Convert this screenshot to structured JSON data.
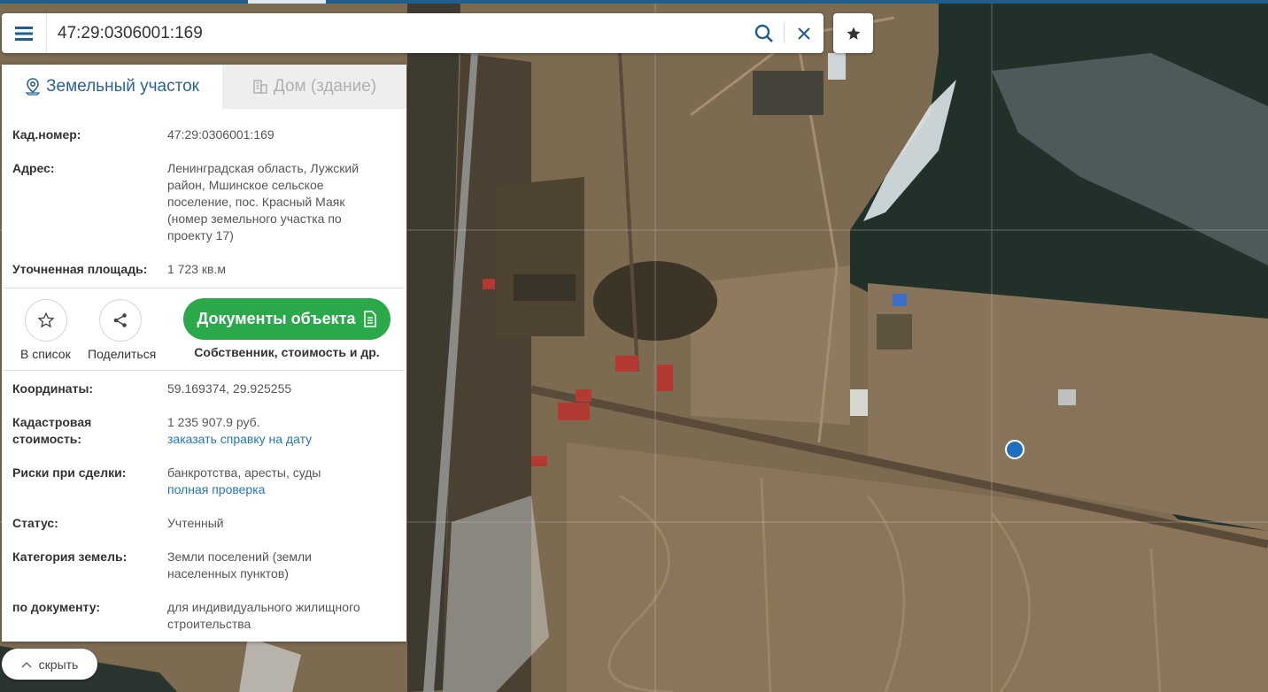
{
  "search": {
    "value": "47:29:0306001:169"
  },
  "tabs": [
    {
      "label": "Земельный участок",
      "active": true
    },
    {
      "label": "Дом (здание)",
      "active": false
    }
  ],
  "parcel": {
    "cadnum_label": "Кад.номер:",
    "cadnum_value": "47:29:0306001:169",
    "address_label": "Адрес:",
    "address_lines": [
      "Ленинградская область, Лужский",
      "район, Мшинское сельское",
      "поселение, пос. Красный Маяк",
      "(номер земельного участка по",
      "проекту 17)"
    ],
    "area_label": "Уточненная площадь:",
    "area_value": "1 723 кв.м"
  },
  "actions": {
    "favorite_label": "В список",
    "share_label": "Поделиться",
    "docs_label": "Документы объекта",
    "docs_sub": "Собственник, стоимость и др."
  },
  "details": {
    "coords_label": "Координаты:",
    "coords_value": "59.169374, 29.925255",
    "cost_label_lines": [
      "Кадастровая",
      "стоимость:"
    ],
    "cost_value": "1 235 907.9 руб.",
    "cost_link": "заказать справку на дату",
    "risks_label": "Риски при сделки:",
    "risks_value": "банкротства, аресты, суды",
    "risks_link": "полная проверка",
    "status_label": "Статус:",
    "status_value": "Учтенный",
    "category_label": "Категория земель:",
    "category_lines": [
      "Земли поселений (земли",
      "населенных пунктов)"
    ],
    "usage_label": "по документу:",
    "usage_lines": [
      "для индивидуального жилищного",
      "строительства"
    ]
  },
  "hide_label": "скрыть",
  "colors": {
    "accent": "#2277c0",
    "docs_button": "#2aa84a",
    "marker": "#1f6fc0"
  }
}
